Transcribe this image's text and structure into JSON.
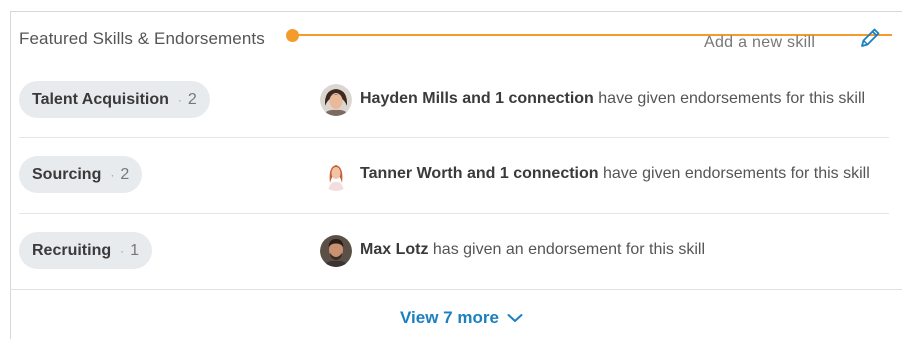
{
  "section": {
    "title": "Featured Skills & Endorsements",
    "add_skill": "Add a new skill"
  },
  "colors": {
    "annotation": "#f39c2c",
    "link": "#1a80c0",
    "pill": "#e8ebee"
  },
  "skills": [
    {
      "name": "Talent Acquisition",
      "separator": "·",
      "count": "2",
      "endorser": "Hayden Mills and 1 connection",
      "text": " have given endorsements for this skill",
      "avatar_icon": "woman-avatar"
    },
    {
      "name": "Sourcing",
      "separator": "·",
      "count": "2",
      "endorser": "Tanner Worth and 1 connection",
      "text": " have given endorsements for this skill",
      "avatar_icon": "woman-red-hair-avatar"
    },
    {
      "name": "Recruiting",
      "separator": "·",
      "count": "1",
      "endorser": "Max Lotz",
      "text": " has given an endorsement for this skill",
      "avatar_icon": "man-avatar"
    }
  ],
  "footer": {
    "view_more": "View 7 more"
  },
  "icons": {
    "edit": "pencil-icon",
    "expand": "chevron-down-icon"
  }
}
